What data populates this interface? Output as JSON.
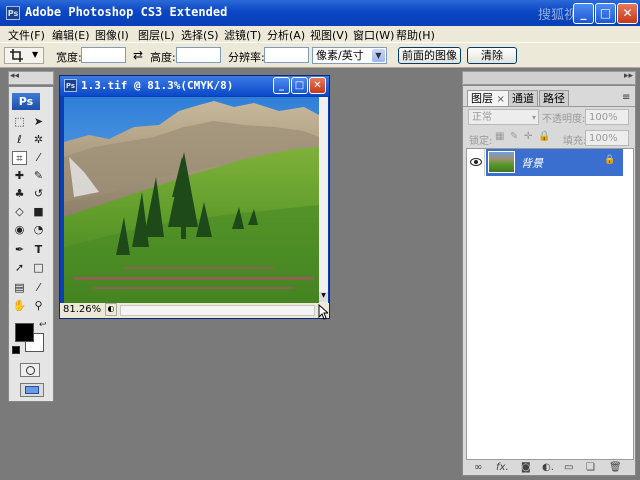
{
  "app": {
    "title": "Adobe Photoshop CS3 Extended",
    "icon": "Ps"
  },
  "window_controls": {
    "minimize": "_",
    "maximize": "□",
    "close": "✕"
  },
  "menu": [
    "文件(F)",
    "编辑(E)",
    "图像(I)",
    "图层(L)",
    "选择(S)",
    "滤镜(T)",
    "分析(A)",
    "视图(V)",
    "窗口(W)",
    "帮助(H)"
  ],
  "options": {
    "tool_icon": "crop-icon",
    "width_label": "宽度:",
    "width_value": "",
    "swap_icon": "⇄",
    "height_label": "高度:",
    "height_value": "",
    "resolution_label": "分辨率:",
    "resolution_value": "",
    "unit_select": "像素/英寸",
    "front_image_button": "前面的图像",
    "clear_button": "清除"
  },
  "toolbox": {
    "logo": "Ps"
  },
  "document": {
    "title": "1.3.tif @ 81.3%(CMYK/8)",
    "zoom": "81.26%"
  },
  "layers_panel": {
    "tabs": [
      {
        "label": "图层",
        "close": "×",
        "active": true
      },
      {
        "label": "通道",
        "active": false
      },
      {
        "label": "路径",
        "active": false
      }
    ],
    "blend_mode": "正常",
    "opacity_label": "不透明度:",
    "opacity_value": "100%",
    "lock_label": "锁定:",
    "fill_label": "填充:",
    "fill_value": "100%",
    "layers": [
      {
        "name": "背景",
        "visible": true,
        "locked": true
      }
    ],
    "bottom_icons": [
      "link-icon",
      "fx-icon",
      "mask-icon",
      "adjustment-icon",
      "group-icon",
      "new-layer-icon",
      "trash-icon"
    ]
  },
  "watermark": "搜狐视频",
  "colors": {
    "titlebar": "#0a46c4",
    "workspace": "#7a7a7a",
    "panel": "#d9d9d9",
    "selection": "#3a6fcf"
  }
}
